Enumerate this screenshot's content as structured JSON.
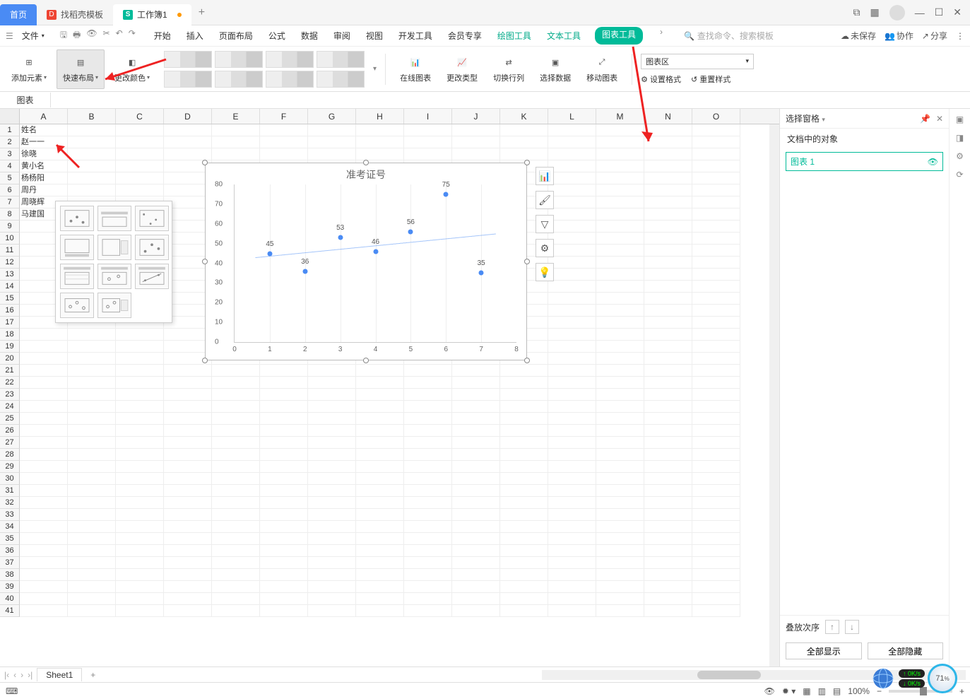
{
  "tabs": {
    "home": "首页",
    "template": "找稻壳模板",
    "workbook": "工作簿1"
  },
  "menu": {
    "file": "文件",
    "items": [
      "开始",
      "插入",
      "页面布局",
      "公式",
      "数据",
      "审阅",
      "视图",
      "开发工具",
      "会员专享"
    ],
    "context": {
      "draw": "绘图工具",
      "text": "文本工具",
      "chart": "图表工具"
    },
    "search_placeholder": "查找命令、搜索模板",
    "right": {
      "unsaved": "未保存",
      "coop": "协作",
      "share": "分享"
    }
  },
  "ribbon": {
    "add_element": "添加元素",
    "quick_layout": "快速布局",
    "change_color": "更改颜色",
    "online_chart": "在线图表",
    "change_type": "更改类型",
    "switch_rc": "切换行列",
    "select_data": "选择数据",
    "move_chart": "移动图表",
    "chart_area_select": "图表区",
    "set_format": "设置格式",
    "reset_style": "重置样式"
  },
  "namebox": "图表",
  "columns": [
    "A",
    "B",
    "C",
    "D",
    "E",
    "F",
    "G",
    "H",
    "I",
    "J",
    "K",
    "L",
    "M",
    "N",
    "O"
  ],
  "cells": {
    "A1": "姓名",
    "A2": "赵一一",
    "A3": "徐晓",
    "A4": "黄小名",
    "A5": "杨杨阳",
    "A6": "周丹",
    "A7": "周晓辉",
    "A8": "马建国"
  },
  "row_count": 41,
  "chart_data": {
    "type": "scatter",
    "title": "准考证号",
    "xlabel": "",
    "ylabel": "",
    "xlim": [
      0,
      8
    ],
    "ylim": [
      0,
      80
    ],
    "xticks": [
      0,
      1,
      2,
      3,
      4,
      5,
      6,
      7,
      8
    ],
    "yticks": [
      0,
      10,
      20,
      30,
      40,
      50,
      60,
      70,
      80
    ],
    "series": [
      {
        "name": "准考证号",
        "x": [
          1,
          2,
          3,
          4,
          5,
          6,
          7
        ],
        "y": [
          45,
          36,
          53,
          46,
          56,
          75,
          35
        ],
        "labels": [
          "45",
          "36",
          "53",
          "46",
          "56",
          "75",
          "35"
        ]
      }
    ],
    "trendline": {
      "x1": 0.6,
      "y1": 43,
      "x2": 7.4,
      "y2": 55
    }
  },
  "chart_tools": [
    "chart-elements",
    "brush",
    "filter",
    "settings",
    "idea"
  ],
  "right_panel": {
    "title": "选择窗格",
    "subtitle": "文档中的对象",
    "items": [
      "图表 1"
    ],
    "stack": "叠放次序",
    "show_all": "全部显示",
    "hide_all": "全部隐藏"
  },
  "sheet": {
    "name": "Sheet1"
  },
  "status": {
    "zoom": "100%",
    "pct_circle": "71",
    "net_up": "0K/s",
    "net_down": "0K/s"
  }
}
